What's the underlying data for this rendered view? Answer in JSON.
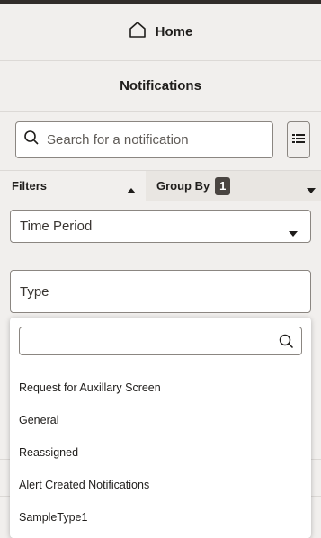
{
  "nav": {
    "home_label": "Home",
    "home_icon": "home-icon"
  },
  "header": {
    "title": "Notifications"
  },
  "search": {
    "placeholder": "Search for a notification",
    "value": ""
  },
  "filter_bar": {
    "filters_label": "Filters",
    "group_by_label": "Group By",
    "group_by_count": "1"
  },
  "filters": {
    "time_period_label": "Time Period",
    "type_label": "Type"
  },
  "type_dropdown": {
    "search_value": "",
    "options": [
      "Request for Auxillary Screen",
      "General",
      "Reassigned",
      "Alert Created Notifications",
      "SampleType1"
    ]
  },
  "colors": {
    "badge_bg": "#4a4541",
    "topbar": "#312d2a",
    "page_bg": "#f1efed"
  }
}
